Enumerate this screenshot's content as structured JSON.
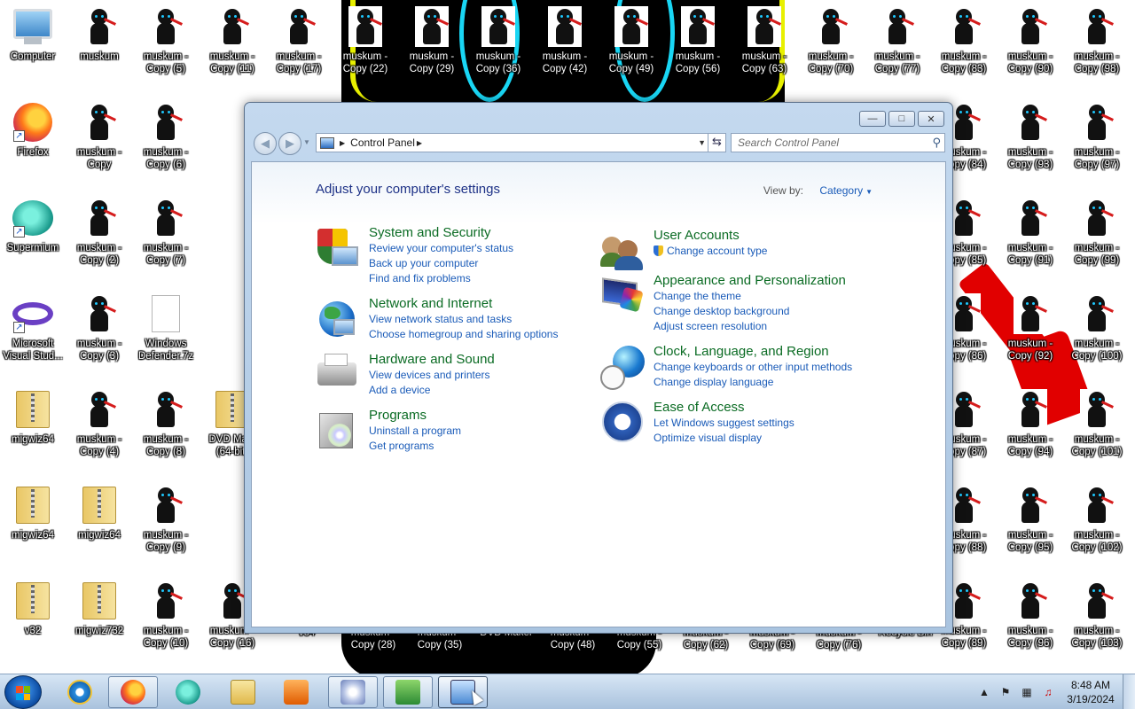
{
  "desktop": {
    "icons": [
      {
        "label": "Computer",
        "kind": "computer"
      },
      {
        "label": "muskum",
        "kind": "figure"
      },
      {
        "label": "muskum - Copy (5)",
        "kind": "figure"
      },
      {
        "label": "muskum - Copy (11)",
        "kind": "figure"
      },
      {
        "label": "muskum - Copy (17)",
        "kind": "figure"
      },
      {
        "label": "muskum - Copy (22)",
        "kind": "figure"
      },
      {
        "label": "muskum - Copy (29)",
        "kind": "figure"
      },
      {
        "label": "muskum - Copy (36)",
        "kind": "figure"
      },
      {
        "label": "muskum - Copy (42)",
        "kind": "figure"
      },
      {
        "label": "muskum - Copy (49)",
        "kind": "figure"
      },
      {
        "label": "muskum - Copy (56)",
        "kind": "figure"
      },
      {
        "label": "muskum - Copy (63)",
        "kind": "figure"
      },
      {
        "label": "muskum - Copy (70)",
        "kind": "figure"
      },
      {
        "label": "muskum - Copy (77)",
        "kind": "figure"
      },
      {
        "label": "muskum - Copy (83)",
        "kind": "figure"
      },
      {
        "label": "muskum - Copy (90)",
        "kind": "figure"
      },
      {
        "label": "muskum - Copy (98)",
        "kind": "figure"
      },
      {
        "label": "Firefox",
        "kind": "firefox"
      },
      {
        "label": "muskum - Copy",
        "kind": "figure"
      },
      {
        "label": "muskum - Copy (6)",
        "kind": "figure"
      },
      {
        "label": "muskum - Copy (84)",
        "kind": "figure"
      },
      {
        "label": "muskum - Copy (93)",
        "kind": "figure"
      },
      {
        "label": "muskum - Copy (97)",
        "kind": "figure"
      },
      {
        "label": "Supermium",
        "kind": "supermium"
      },
      {
        "label": "muskum - Copy (2)",
        "kind": "figure"
      },
      {
        "label": "muskum - Copy (7)",
        "kind": "figure"
      },
      {
        "label": "muskum - Copy (85)",
        "kind": "figure"
      },
      {
        "label": "muskum - Copy (91)",
        "kind": "figure"
      },
      {
        "label": "muskum - Copy (99)",
        "kind": "figure"
      },
      {
        "label": "Microsoft Visual Stud...",
        "kind": "vs"
      },
      {
        "label": "muskum - Copy (3)",
        "kind": "figure"
      },
      {
        "label": "Windows Defender.7z",
        "kind": "doc"
      },
      {
        "label": "muskum - Copy (86)",
        "kind": "figure"
      },
      {
        "label": "muskum - Copy (92)",
        "kind": "figure"
      },
      {
        "label": "muskum - Copy (100)",
        "kind": "figure"
      },
      {
        "label": "migwiz64",
        "kind": "zip"
      },
      {
        "label": "muskum - Copy (4)",
        "kind": "figure"
      },
      {
        "label": "muskum - Copy (8)",
        "kind": "figure"
      },
      {
        "label": "DVD Ma... (64-bit)",
        "kind": "zip"
      },
      {
        "label": "muskum - Copy (87)",
        "kind": "figure"
      },
      {
        "label": "muskum - Copy (94)",
        "kind": "figure"
      },
      {
        "label": "muskum - Copy (101)",
        "kind": "figure"
      },
      {
        "label": "migwiz64",
        "kind": "zip"
      },
      {
        "label": "migwiz64",
        "kind": "zip"
      },
      {
        "label": "muskum - Copy (9)",
        "kind": "figure"
      },
      {
        "label": "muskum - Copy (88)",
        "kind": "figure"
      },
      {
        "label": "muskum - Copy (95)",
        "kind": "figure"
      },
      {
        "label": "muskum - Copy (102)",
        "kind": "figure"
      },
      {
        "label": "v32",
        "kind": "zip"
      },
      {
        "label": "migwiz732",
        "kind": "zip"
      },
      {
        "label": "muskum - Copy (10)",
        "kind": "figure"
      },
      {
        "label": "muskum - Copy (16)",
        "kind": "figure"
      },
      {
        "label": "muskum - Copy (89)",
        "kind": "figure"
      },
      {
        "label": "muskum - Copy (96)",
        "kind": "figure"
      },
      {
        "label": "muskum - Copy (103)",
        "kind": "figure"
      }
    ],
    "bottom_labels": [
      "v64",
      "muskum - Copy (28)",
      "muskum - Copy (35)",
      "DVD Maker",
      "muskum - Copy (48)",
      "muskum - Copy (55)",
      "muskum - Copy (62)",
      "muskum - Copy (69)",
      "muskum - Copy (76)",
      "Recycle Bin"
    ]
  },
  "window": {
    "title": "Control Panel",
    "address": {
      "crumb": "Control Panel"
    },
    "search": {
      "placeholder": "Search Control Panel"
    },
    "heading": "Adjust your computer's settings",
    "view_by_label": "View by:",
    "view_by_value": "Category",
    "left_categories": [
      {
        "title": "System and Security",
        "icon": "shield-icon",
        "links": [
          "Review your computer's status",
          "Back up your computer",
          "Find and fix problems"
        ]
      },
      {
        "title": "Network and Internet",
        "icon": "network-globe-icon",
        "links": [
          "View network status and tasks",
          "Choose homegroup and sharing options"
        ]
      },
      {
        "title": "Hardware and Sound",
        "icon": "printer-icon",
        "links": [
          "View devices and printers",
          "Add a device"
        ]
      },
      {
        "title": "Programs",
        "icon": "programs-icon",
        "links": [
          "Uninstall a program",
          "Get programs"
        ]
      }
    ],
    "right_categories": [
      {
        "title": "User Accounts",
        "icon": "users-icon",
        "links": [
          "Change account type"
        ]
      },
      {
        "title": "Appearance and Personalization",
        "icon": "personalization-icon",
        "links": [
          "Change the theme",
          "Change desktop background",
          "Adjust screen resolution"
        ]
      },
      {
        "title": "Clock, Language, and Region",
        "icon": "clock-globe-icon",
        "links": [
          "Change keyboards or other input methods",
          "Change display language"
        ]
      },
      {
        "title": "Ease of Access",
        "icon": "ease-of-access-icon",
        "links": [
          "Let Windows suggest settings",
          "Optimize visual display"
        ]
      }
    ]
  },
  "taskbar": {
    "time": "8:48 AM",
    "date": "3/19/2024",
    "buttons": [
      "start",
      "internet-explorer",
      "firefox",
      "supermium",
      "windows-explorer",
      "media-player",
      "dvd-maker",
      "migwiz",
      "control-panel"
    ]
  }
}
